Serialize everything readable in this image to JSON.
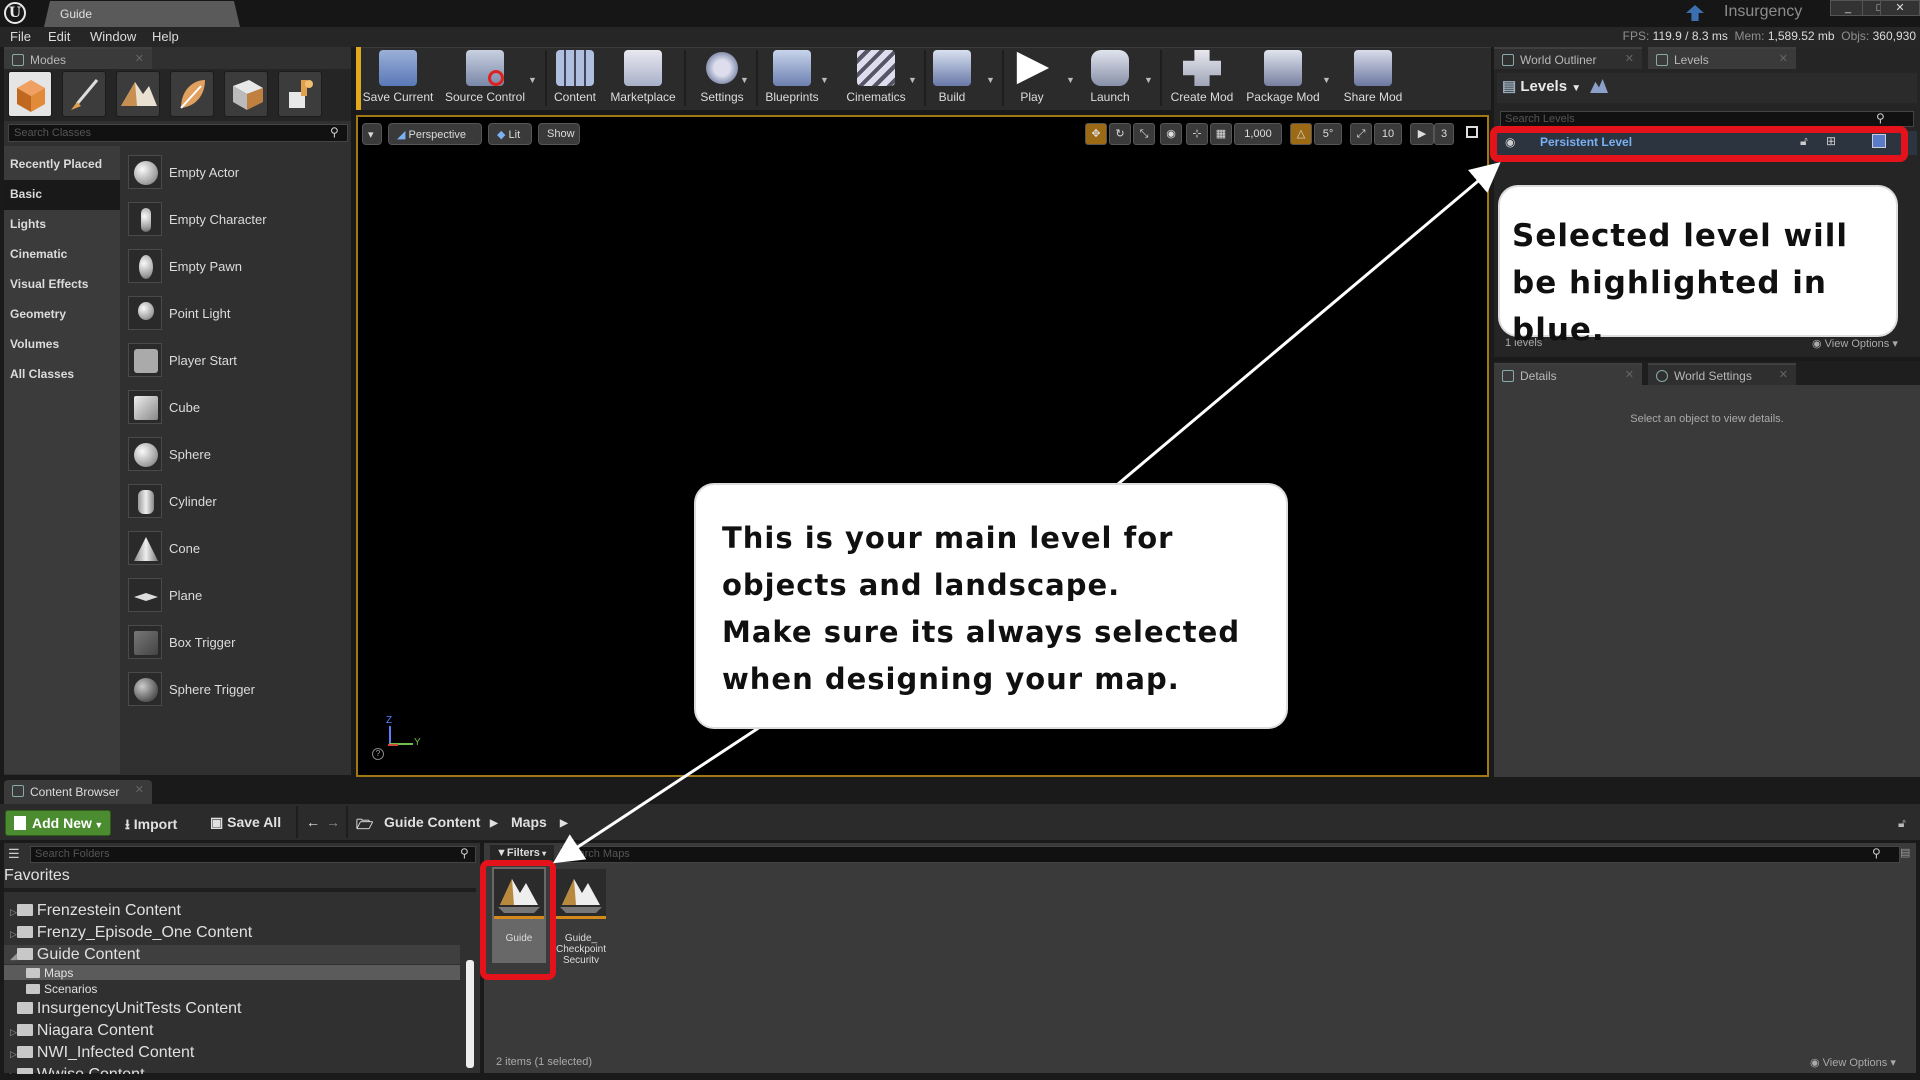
{
  "window": {
    "doc_tab": "Guide",
    "project": "Insurgency",
    "controls": [
      "_",
      "□",
      "✕"
    ]
  },
  "menu": [
    "File",
    "Edit",
    "Window",
    "Help"
  ],
  "stats": {
    "fps_label": "FPS:",
    "fps": "119.9",
    "ms": "/ 8.3 ms",
    "mem_label": "Mem:",
    "mem": "1,589.52 mb",
    "objs_label": "Objs:",
    "objs": "360,930"
  },
  "modes": {
    "tab": "Modes",
    "search_placeholder": "Search Classes",
    "categories": [
      "Recently Placed",
      "Basic",
      "Lights",
      "Cinematic",
      "Visual Effects",
      "Geometry",
      "Volumes",
      "All Classes"
    ],
    "selected_category": "Basic",
    "items": [
      "Empty Actor",
      "Empty Character",
      "Empty Pawn",
      "Point Light",
      "Player Start",
      "Cube",
      "Sphere",
      "Cylinder",
      "Cone",
      "Plane",
      "Box Trigger",
      "Sphere Trigger"
    ]
  },
  "toolbar": [
    "Save Current",
    "Source Control",
    "Content",
    "Marketplace",
    "Settings",
    "Blueprints",
    "Cinematics",
    "Build",
    "Play",
    "Launch",
    "Create Mod",
    "Package Mod",
    "Share Mod"
  ],
  "viewport": {
    "perspective": "Perspective",
    "lit": "Lit",
    "show": "Show",
    "grid_size": "1,000",
    "rot_snap": "5°",
    "scale_snap": "10",
    "cam_speed": "3",
    "axis_z": "Z",
    "axis_y": "Y"
  },
  "right_top": {
    "tabs": [
      "World Outliner",
      "Levels"
    ],
    "levels_title": "Levels",
    "search_placeholder": "Search Levels",
    "persistent_level": "Persistent Level",
    "levels_count": "1 levels",
    "view_options": "View Options"
  },
  "right_bottom": {
    "tabs": [
      "Details",
      "World Settings"
    ],
    "empty_text": "Select an object to view details."
  },
  "callouts": {
    "levels": "Selected level will be highlighted in blue.",
    "main_level_lines": [
      "This is your main level for",
      "objects and landscape.",
      "Make sure its always selected",
      "when designing your map."
    ]
  },
  "content_browser": {
    "tab": "Content Browser",
    "add_new": "Add New",
    "import": "Import",
    "save_all": "Save All",
    "path": [
      "Guide Content",
      "Maps"
    ],
    "search_folders_placeholder": "Search Folders",
    "favorites": "Favorites",
    "folders": [
      "Frenzestein Content",
      "Frenzy_Episode_One Content",
      "Guide Content",
      "Maps",
      "Scenarios",
      "InsurgencyUnitTests Content",
      "Niagara Content",
      "NWI_Infected Content",
      "Wwise Content"
    ],
    "filters": "Filters",
    "search_assets_placeholder": "Search Maps",
    "assets": [
      "Guide",
      "Guide_ Checkpoint Security"
    ],
    "items_count": "2 items (1 selected)",
    "view_options": "View Options"
  },
  "colors": {
    "highlight_red": "#e3121b",
    "selected_blue": "#79b1f3",
    "viewport_border": "#a07914",
    "add_new_green": "#4b8c30"
  }
}
